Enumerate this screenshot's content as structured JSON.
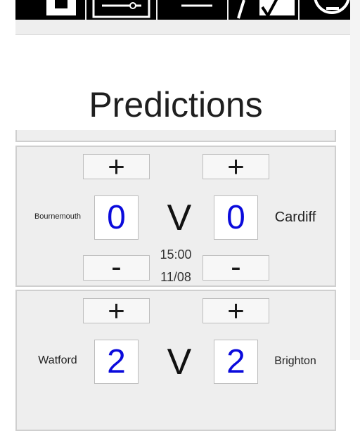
{
  "nav": {
    "tabs": [
      {
        "icon": "table-icon"
      },
      {
        "icon": "filter-icon"
      },
      {
        "icon": "menu-line-icon"
      },
      {
        "icon": "chart-icon"
      },
      {
        "icon": "info-icon"
      }
    ]
  },
  "page": {
    "title": "Predictions"
  },
  "matches": [
    {
      "home_team": "Bournemouth",
      "away_team": "Cardiff",
      "home_score": "0",
      "away_score": "0",
      "vs": "V",
      "time": "15:00",
      "date": "11/08",
      "plus_label": "+",
      "minus_label": "-"
    },
    {
      "home_team": "Watford",
      "away_team": "Brighton",
      "home_score": "2",
      "away_score": "2",
      "vs": "V",
      "time": "",
      "date": "",
      "plus_label": "+",
      "minus_label": "-"
    }
  ],
  "colors": {
    "score_text": "#0a0adc",
    "card_background": "#eeeeee",
    "nav_tab": "#000000"
  }
}
